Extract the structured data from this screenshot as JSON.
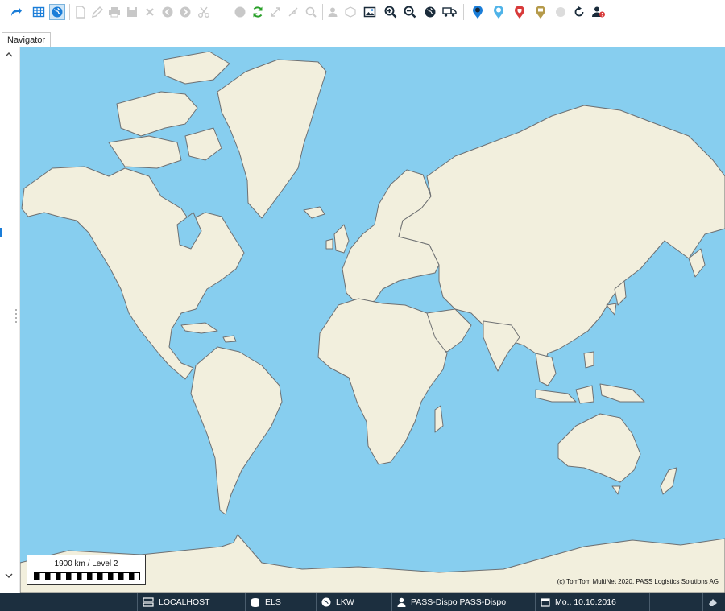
{
  "toolbar": {
    "buttons": [
      {
        "name": "redo-icon",
        "enabled": true
      },
      {
        "name": "table-view-icon",
        "enabled": true
      },
      {
        "name": "map-view-icon",
        "enabled": true,
        "active": true
      },
      {
        "name": "new-document-icon",
        "enabled": false
      },
      {
        "name": "edit-icon",
        "enabled": false
      },
      {
        "name": "print-icon",
        "enabled": false
      },
      {
        "name": "save-icon",
        "enabled": false
      },
      {
        "name": "delete-icon",
        "enabled": false
      },
      {
        "name": "previous-icon",
        "enabled": false
      },
      {
        "name": "next-icon",
        "enabled": false
      },
      {
        "name": "cut-icon",
        "enabled": false
      },
      {
        "name": "stop-icon",
        "enabled": false
      },
      {
        "name": "refresh-icon",
        "enabled": true
      },
      {
        "name": "expand-icon",
        "enabled": false
      },
      {
        "name": "collapse-icon",
        "enabled": false
      },
      {
        "name": "search-icon",
        "enabled": false
      },
      {
        "name": "user-icon",
        "enabled": false
      },
      {
        "name": "box-icon",
        "enabled": false
      },
      {
        "name": "image-export-icon",
        "enabled": true
      },
      {
        "name": "zoom-in-icon",
        "enabled": true
      },
      {
        "name": "zoom-out-icon",
        "enabled": true
      },
      {
        "name": "globe-icon",
        "enabled": true
      },
      {
        "name": "truck-icon",
        "enabled": true
      },
      {
        "name": "location-pin-icon",
        "enabled": true
      },
      {
        "name": "waypoint-pin-icon",
        "enabled": true
      },
      {
        "name": "shield-pin-icon",
        "enabled": true
      },
      {
        "name": "depot-pin-icon",
        "enabled": true
      },
      {
        "name": "circle-icon",
        "enabled": false
      },
      {
        "name": "reload-icon",
        "enabled": true
      },
      {
        "name": "alert-person-icon",
        "enabled": true
      }
    ]
  },
  "tabs": {
    "navigator": "Navigator"
  },
  "map": {
    "scale_label": "1900 km / Level 2",
    "copyright": "(c) TomTom MultiNet 2020, PASS Logistics Solutions AG"
  },
  "status": {
    "server": "LOCALHOST",
    "database": "ELS",
    "fleet": "LKW",
    "user": "PASS-Dispo PASS-Dispo",
    "date": "Mo., 10.10.2016"
  },
  "colors": {
    "ocean": "#87ceef",
    "land": "#f2efdd",
    "coast": "#6e7072",
    "statusbar": "#1c2f3f",
    "accent": "#1a7dd8"
  }
}
